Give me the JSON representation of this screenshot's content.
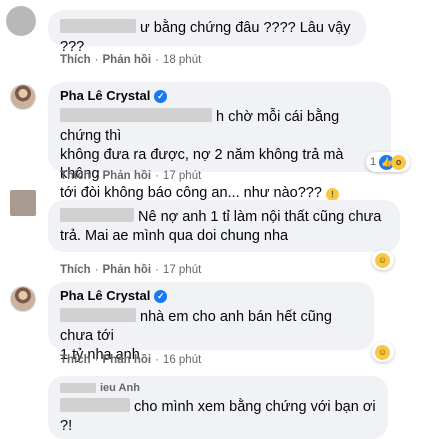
{
  "comments": [
    {
      "author": "",
      "text": "ư bằng chứng đâu ???? Lâu vậy ???",
      "like": "Thích",
      "reply": "Phản hồi",
      "time": "18 phút"
    },
    {
      "author": "Pha Lê Crystal",
      "verified": true,
      "line1": "h chờ mỗi cái bằng chứng thì",
      "line2": "không đưa ra được, nợ 2 năm không trả mà không",
      "line3": "tới đòi không báo công an... như nào???",
      "like": "Thích",
      "reply": "Phản hồi",
      "time": "17 phút",
      "reaction_count": "1"
    },
    {
      "author": "",
      "line1": "Nê nợ anh 1 tỉ làm nội thất cũng chưa",
      "line2": "trả. Mai ae mình qua doi chung nha",
      "like": "Thích",
      "reply": "Phản hồi",
      "time": "17 phút"
    },
    {
      "author": "Pha Lê Crystal",
      "verified": true,
      "line1": "nhà em cho anh bán hết cũng chưa tới",
      "line2": "1 tỷ nha anh",
      "like": "Thích",
      "reply": "Phản hồi",
      "time": "16 phút"
    },
    {
      "author": "ieu Anh",
      "line1": "cho mình xem bằng chứng với bạn ơi",
      "line2": "?!"
    }
  ],
  "icons": {
    "verified": "verified-badge-icon",
    "like": "like-reaction-icon",
    "wow": "wow-reaction-icon",
    "haha": "haha-reaction-icon"
  },
  "colors": {
    "bubble": "#f0f2f5",
    "meta": "#65676b",
    "verified": "#1877f2"
  }
}
